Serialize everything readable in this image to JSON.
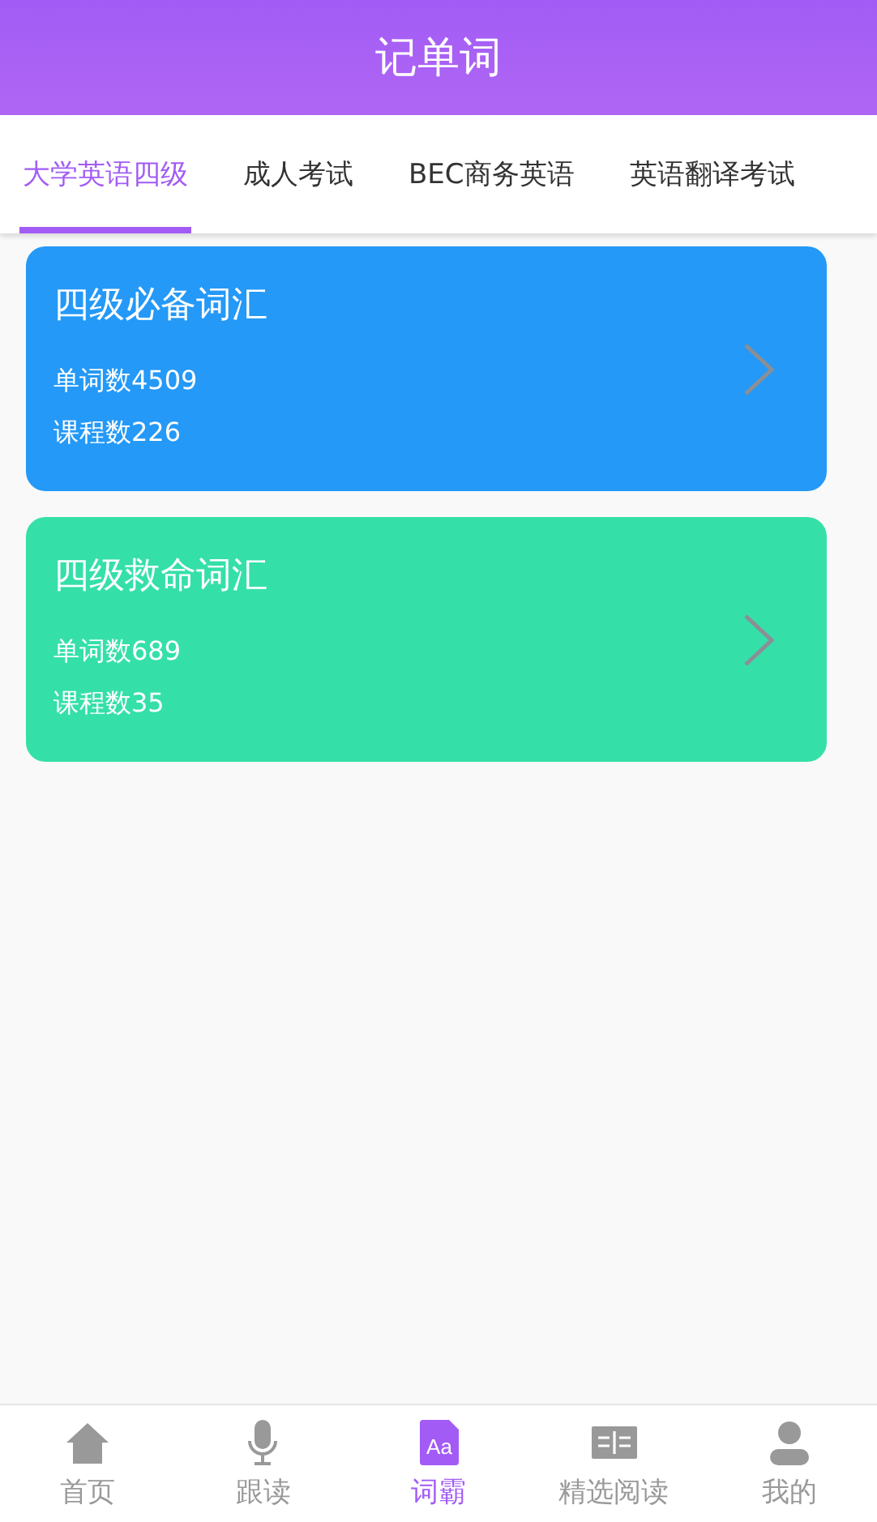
{
  "header": {
    "title": "记单词"
  },
  "tabs": [
    {
      "label": "大学英语四级",
      "selected": true
    },
    {
      "label": "成人考试",
      "selected": false
    },
    {
      "label": "BEC商务英语",
      "selected": false
    },
    {
      "label": "英语翻译考试",
      "selected": false
    }
  ],
  "cards": [
    {
      "title": "四级必备词汇",
      "words": "单词数4509",
      "lessons": "课程数226",
      "color": "#2499f7"
    },
    {
      "title": "四级救命词汇",
      "words": "单词数689",
      "lessons": "课程数35",
      "color": "#35e0a8"
    }
  ],
  "nav": [
    {
      "label": "首页",
      "kind": "home",
      "selected": false
    },
    {
      "label": "跟读",
      "kind": "mic",
      "selected": false
    },
    {
      "label": "词霸",
      "kind": "dict",
      "icon_text": "Aa",
      "selected": true
    },
    {
      "label": "精选阅读",
      "kind": "book",
      "selected": false
    },
    {
      "label": "我的",
      "kind": "person",
      "selected": false
    }
  ]
}
